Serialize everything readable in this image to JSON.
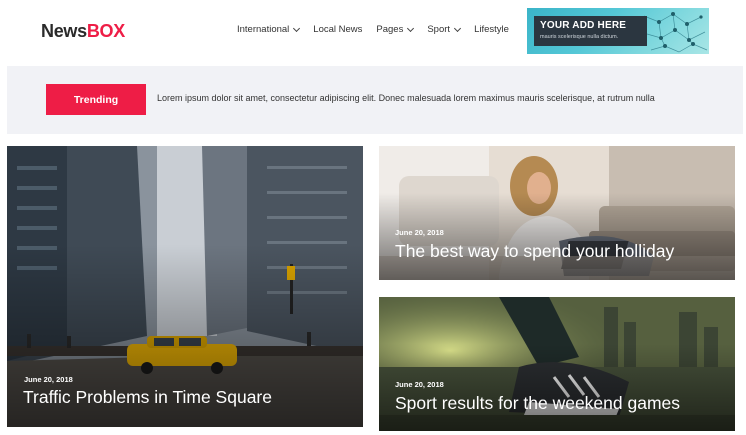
{
  "header": {
    "logo_part1": "News",
    "logo_part2": "BOX",
    "nav": [
      {
        "label": "International",
        "dropdown": true
      },
      {
        "label": "Local News",
        "dropdown": false
      },
      {
        "label": "Pages",
        "dropdown": true
      },
      {
        "label": "Sport",
        "dropdown": true
      },
      {
        "label": "Lifestyle",
        "dropdown": false
      }
    ],
    "ad": {
      "title": "YOUR ADD HERE",
      "subtitle": "mauris scelerisque nulla dictum."
    }
  },
  "trending": {
    "button_label": "Trending",
    "text": "Lorem ipsum dolor sit amet, consectetur adipiscing elit. Donec malesuada lorem maximus mauris scelerisque, at rutrum nulla"
  },
  "articles": [
    {
      "date": "June 20, 2018",
      "title": "Traffic Problems in Time Square"
    },
    {
      "date": "June 20, 2018",
      "title": "The best way to spend your holliday"
    },
    {
      "date": "June 20, 2018",
      "title": "Sport results for the weekend games"
    }
  ],
  "colors": {
    "brand_red": "#ee1d46",
    "trending_bg": "#f1f2f6",
    "ad_dark": "#2b3640"
  }
}
